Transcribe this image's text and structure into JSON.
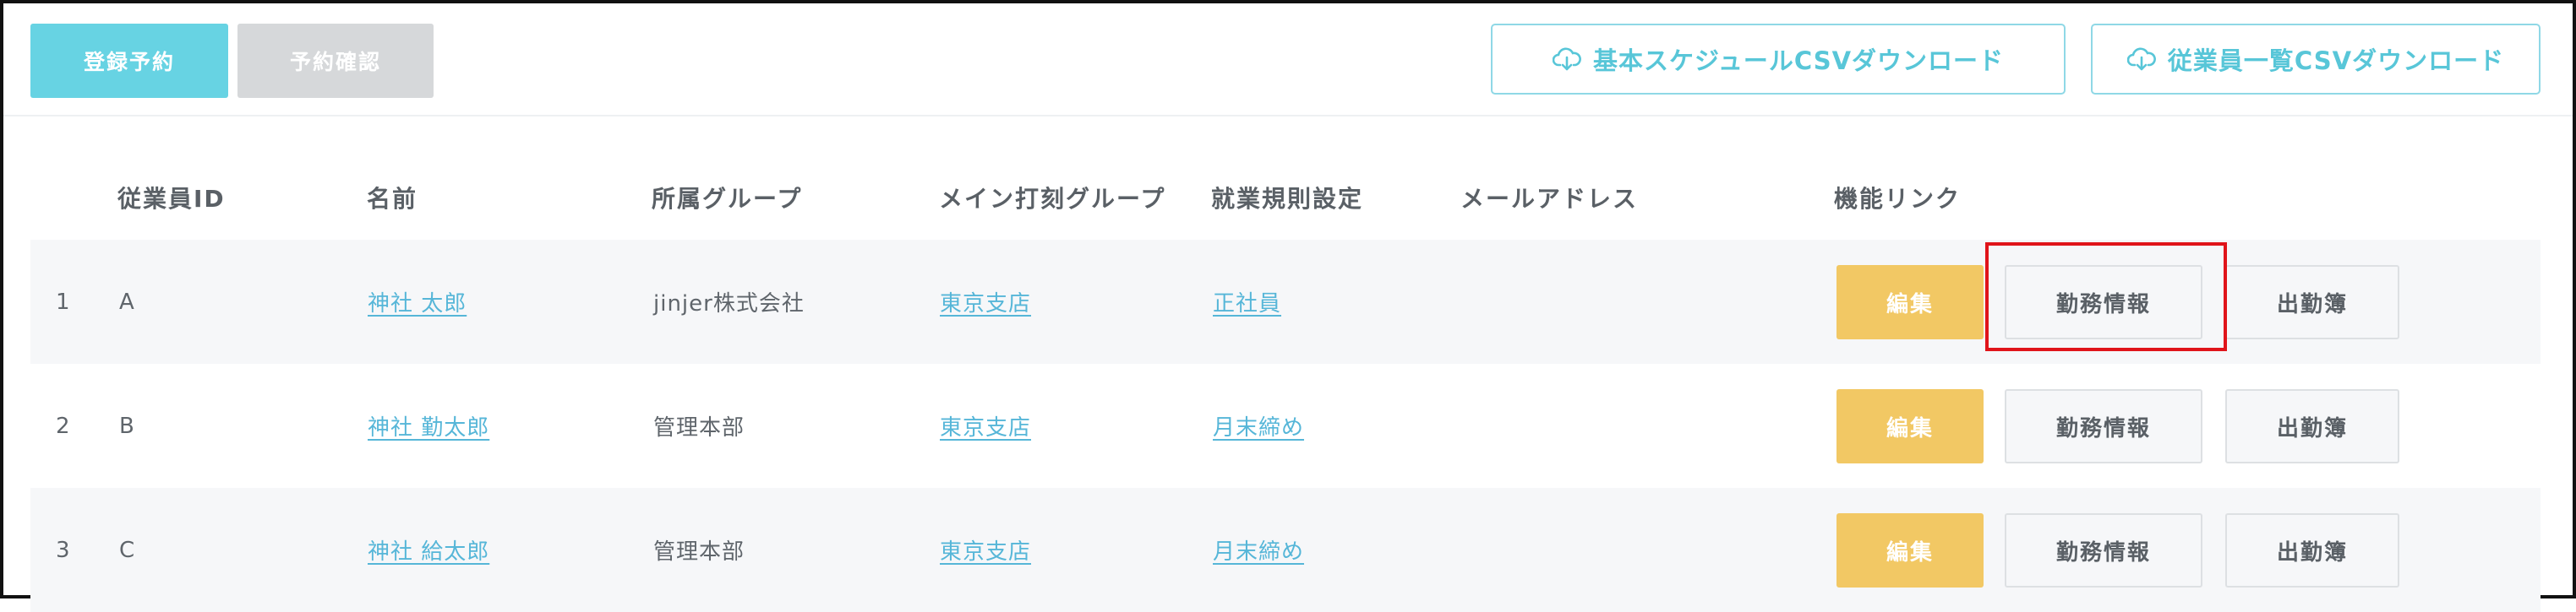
{
  "toolbar": {
    "register_reservation": "登録予約",
    "reservation_confirm": "予約確認",
    "schedule_csv": "基本スケジュールCSVダウンロード",
    "employee_csv": "従業員一覧CSVダウンロード"
  },
  "columns": {
    "employee_id": "従業員ID",
    "name": "名前",
    "group": "所属グループ",
    "main_punch_group": "メイン打刻グループ",
    "work_rule": "就業規則設定",
    "email": "メールアドレス",
    "links": "機能リンク"
  },
  "rows": [
    {
      "no": "1",
      "id": "A",
      "name": "神社 太郎",
      "group": "jinjer株式会社",
      "main_group": "東京支店",
      "rule": "正社員",
      "email": "",
      "edit": "編集",
      "work_info": "勤務情報",
      "attendance": "出勤簿"
    },
    {
      "no": "2",
      "id": "B",
      "name": "神社 勤太郎",
      "group": "管理本部",
      "main_group": "東京支店",
      "rule": "月末締め",
      "email": "",
      "edit": "編集",
      "work_info": "勤務情報",
      "attendance": "出勤簿"
    },
    {
      "no": "3",
      "id": "C",
      "name": "神社 給太郎",
      "group": "管理本部",
      "main_group": "東京支店",
      "rule": "月末締め",
      "email": "",
      "edit": "編集",
      "work_info": "勤務情報",
      "attendance": "出勤簿"
    }
  ],
  "icons": {
    "download": "cloud-download-icon"
  },
  "colors": {
    "accent": "#67d3e3",
    "edit": "#f2c864",
    "link": "#56b6d8",
    "highlight": "#e0141a"
  }
}
